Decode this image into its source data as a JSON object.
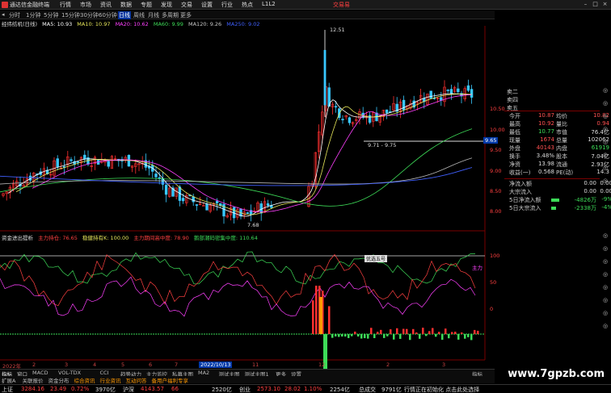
{
  "titlebar": {
    "app_title": "通达信金融终端",
    "menus": [
      "行情",
      "市场",
      "资讯",
      "数据",
      "专题",
      "发现",
      "交易",
      "设置",
      "行业",
      "热点",
      "L1L2"
    ],
    "trade_link": "交易易"
  },
  "periods": [
    {
      "label": "分时",
      "active": false
    },
    {
      "label": "1分钟",
      "active": false
    },
    {
      "label": "5分钟",
      "active": false
    },
    {
      "label": "15分钟",
      "active": false
    },
    {
      "label": "30分钟",
      "active": false
    },
    {
      "label": "60分钟",
      "active": false
    },
    {
      "label": "日线",
      "active": true
    },
    {
      "label": "周线",
      "active": false
    },
    {
      "label": "月线",
      "active": false
    },
    {
      "label": "多周期",
      "active": false
    },
    {
      "label": "更多",
      "active": false
    }
  ],
  "ma_legend": {
    "title": "经纬纺机(日线)",
    "ma5": "MA5: 10.93",
    "ma10": "MA10: 10.97",
    "ma20": "MA20: 10.62",
    "ma60": "MA60: 9.99",
    "ma120": "MA120: 9.26",
    "ma250": "MA250: 9.02"
  },
  "price_axis": [
    "10.50",
    "10.00",
    "9.50",
    "9.00",
    "8.50",
    "8.00",
    "7.50"
  ],
  "price_labels": {
    "high": "12.51",
    "low": "7.68",
    "range": "9.71 - 9.75",
    "current": "9.65"
  },
  "sub_legend": {
    "title": "资金进出提析",
    "items": [
      "主力持仓: 76.65",
      "稳健持有K: 100.00",
      "主力期间高中度: 78.90",
      "鹅部潮码密集中度: 110.64"
    ]
  },
  "sub_axis": [
    "100",
    "50",
    "0"
  ],
  "sub_labels": {
    "main": "主力",
    "panel_title": "优选五号"
  },
  "x_axis": {
    "dates": [
      "2022年",
      "2",
      "3",
      "4",
      "5",
      "6",
      "7",
      "8",
      "9",
      "10",
      "11",
      "12",
      "1",
      "2",
      "3",
      "4"
    ],
    "highlight_date": "2022/10/13"
  },
  "order_book": {
    "sell": [
      "卖二",
      "卖四",
      "卖五"
    ]
  },
  "quote": {
    "rows": [
      {
        "l1": "今开",
        "v1": "10.87",
        "l2": "均价",
        "v2": "10.82"
      },
      {
        "l1": "最高",
        "v1": "10.92",
        "l2": "量比",
        "v2": "0.94"
      },
      {
        "l1": "最低",
        "v1": "10.77",
        "l2": "市值",
        "v2": "76.4亿"
      },
      {
        "l1": "现量",
        "v1": "1674",
        "l2": "总量",
        "v2": "102062"
      },
      {
        "l1": "外盘",
        "v1": "40143",
        "l2": "内盘",
        "v2": "61919"
      },
      {
        "l1": "换手",
        "v1": "3.48%",
        "l2": "股本",
        "v2": "7.04亿"
      },
      {
        "l1": "净资",
        "v1": "13.98",
        "l2": "流通",
        "v2": "2.93亿"
      },
      {
        "l1": "收益(一)",
        "v1": "0.568",
        "l2": "PE(动)",
        "v2": "14.3"
      }
    ],
    "flows": [
      {
        "label": "净流入额",
        "value": "0.00",
        "pct": "0.00"
      },
      {
        "label": "大宗流入",
        "value": "0.00",
        "pct": "0.00"
      },
      {
        "label": "5日净流入额",
        "value": "-4826万",
        "pct": "-9%"
      },
      {
        "label": "5日大宗流入",
        "value": "-2338万",
        "pct": "-4%"
      }
    ]
  },
  "tabs": [
    "指标",
    "窗口",
    "MACD",
    "VOL-TDX",
    "CCI",
    "趋势动力",
    "主力监控",
    "私募主图",
    "MA2",
    "测试主图",
    "测试主图1",
    "更多",
    "设置"
  ],
  "tabs2": [
    "扩展A",
    "关联报价",
    "资金分布",
    "综合资讯",
    "行业资讯",
    "互动问答",
    "备用户福利专享"
  ],
  "tab_right": "指标",
  "status": {
    "sh_label": "上证",
    "sh_index": "3284.16",
    "sh_chg": "23.49",
    "sh_pct": "0.72%",
    "sh_amt": "3970亿",
    "sz_label": "沪深",
    "sz_index": "4143.57",
    "sz_chg": "66",
    "sz_pct": "",
    "sz_amt": "2520亿",
    "cy_label": "创业",
    "cy_index": "2573.10",
    "cy_chg": "28.02",
    "cy_pct": "1.10%",
    "cy_amt": "2254亿",
    "total_label": "总成交",
    "total_amt": "9791亿",
    "msg": "行情正在初始化 点击此处选择"
  },
  "watermark": "www.7gpzb.com",
  "colors": {
    "up": "#ff3030",
    "down": "#3ddc58",
    "ma5": "#ffffff",
    "ma10": "#e6e65a",
    "ma20": "#ff40ff",
    "ma60": "#3ddc58",
    "ma120": "#b8b8b8",
    "ma250": "#4060ff"
  }
}
